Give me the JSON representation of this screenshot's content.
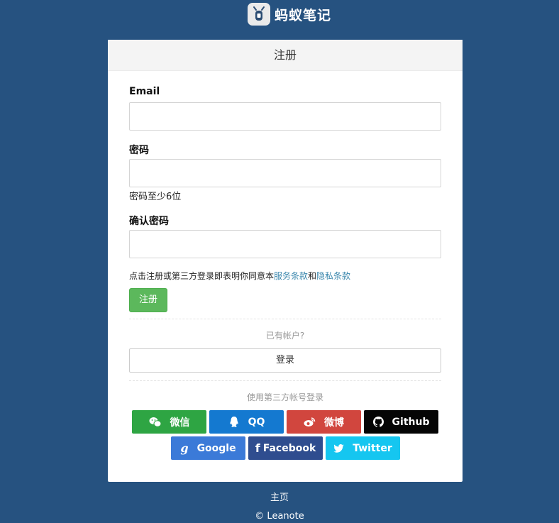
{
  "logo": {
    "text": "蚂蚁笔记"
  },
  "card": {
    "title": "注册",
    "email_label": "Email",
    "password_label": "密码",
    "password_help": "密码至少6位",
    "confirm_label": "确认密码",
    "terms_prefix": "点击注册或第三方登录即表明你同意本",
    "terms_service": "服务条款",
    "terms_and": "和",
    "terms_privacy": "隐私条款",
    "register_button": "注册",
    "have_account": "已有帐户?",
    "login_button": "登录",
    "third_party_note": "使用第三方帐号登录"
  },
  "social": [
    {
      "label": "微信",
      "icon": "wechat-icon",
      "color": "#2ea543"
    },
    {
      "label": "QQ",
      "icon": "qq-icon",
      "color": "#1479d0"
    },
    {
      "label": "微博",
      "icon": "weibo-icon",
      "color": "#d1463e"
    },
    {
      "label": "Github",
      "icon": "github-icon",
      "color": "#050505"
    },
    {
      "label": "Google",
      "icon": "google-icon",
      "color": "#3b7ad8"
    },
    {
      "label": "Facebook",
      "icon": "facebook-icon",
      "color": "#2f4d8f"
    },
    {
      "label": "Twitter",
      "icon": "twitter-icon",
      "color": "#15c6f0"
    }
  ],
  "footer": {
    "home_link": "主页",
    "copyright": "© Leanote"
  },
  "colors": {
    "background": "#265280",
    "register_green": "#5cb85c",
    "link_blue": "#3a87ad"
  }
}
